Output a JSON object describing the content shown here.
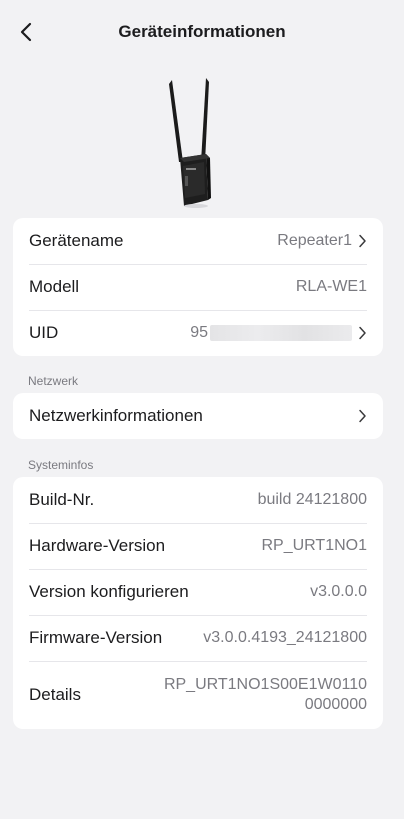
{
  "header": {
    "title": "Geräteinformationen",
    "back_icon": "chevron-left-icon"
  },
  "device": {
    "image": "repeater-device-image"
  },
  "info": {
    "rows": [
      {
        "label": "Gerätename",
        "value": "Repeater1",
        "chevron": true
      },
      {
        "label": "Modell",
        "value": "RLA-WE1",
        "chevron": false
      },
      {
        "label": "UID",
        "value": "95",
        "chevron": true,
        "redacted": true
      }
    ]
  },
  "network": {
    "section_label": "Netzwerk",
    "row": {
      "label": "Netzwerkinformationen",
      "chevron": true
    }
  },
  "system": {
    "section_label": "Systeminfos",
    "rows": [
      {
        "label": "Build-Nr.",
        "value": "build 24121800"
      },
      {
        "label": "Hardware-Version",
        "value": "RP_URT1NO1"
      },
      {
        "label": "Version konfigurieren",
        "value": "v3.0.0.0"
      },
      {
        "label": "Firmware-Version",
        "value": "v3.0.0.4193_24121800"
      },
      {
        "label": "Details",
        "value_line1": "RP_URT1NO1S00E1W0110",
        "value_line2": "0000000"
      }
    ]
  },
  "colors": {
    "background": "#f2f2f4",
    "card": "#ffffff",
    "secondary_text": "#7a7a80"
  }
}
